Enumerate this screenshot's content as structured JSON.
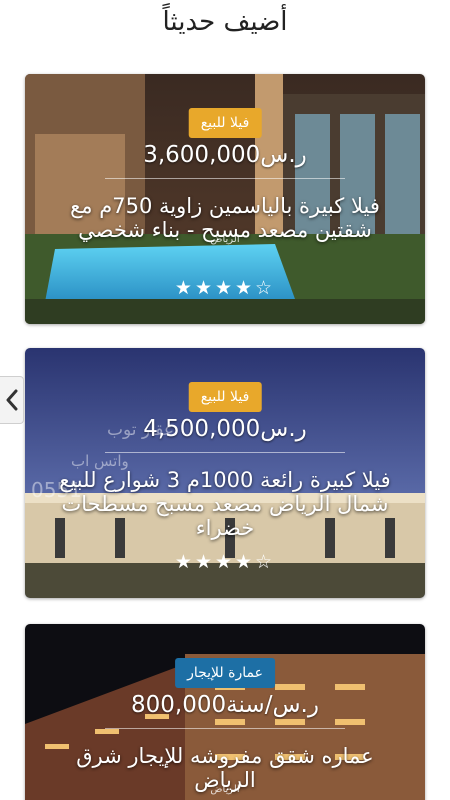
{
  "header": {
    "title": "أضيف حديثاً"
  },
  "listings": [
    {
      "badge": "فيلا للبيع",
      "badge_color": "#e8a82b",
      "price": "3,600,000ر.س",
      "title": "فيلا كبيرة بالياسمين زاوية 750م مع شقتين مصعد مسبح - بناء شخصي",
      "location": "الرياض",
      "rating": 4,
      "stars": "★★★★☆"
    },
    {
      "badge": "فيلا للبيع",
      "badge_color": "#e8a82b",
      "price": "4,500,000ر.س",
      "title": "فيلا كبيرة رائعة 1000م 3 شوارع للبيع شمال الرياض مصعد مسبح مسطحات خضراء",
      "location": "الرياض",
      "rating": 4,
      "stars": "★★★★☆",
      "watermark_line1": "عقار توب",
      "watermark_line2": "واتس اب",
      "watermark_phone": "0551"
    },
    {
      "badge": "عمارة للإيجار",
      "badge_color": "#1d6fa5",
      "price": "800,000ر.س/سنة",
      "title": "عماره شقق مفروشه للإيجار شرق الرياض",
      "location": "الرياض"
    }
  ],
  "nav": {
    "prev_icon": "chevron-left-icon"
  }
}
